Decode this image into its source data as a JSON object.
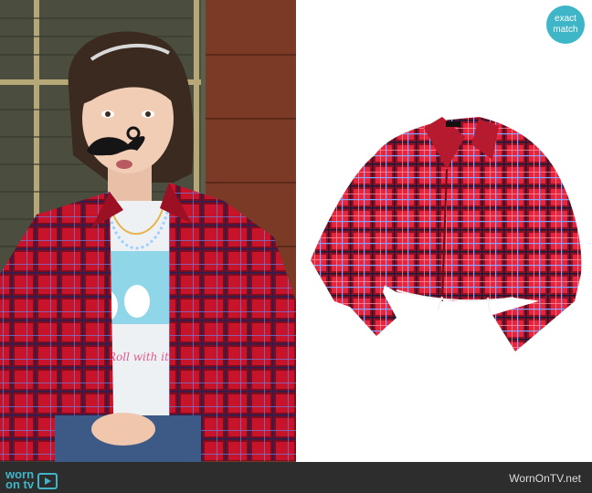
{
  "badge": {
    "line1": "exact",
    "line2": "match"
  },
  "footer": {
    "logo_word1": "worn",
    "logo_word2": "on tv",
    "credit": "WornOnTV.net"
  },
  "colors": {
    "accent": "#3fb6c8",
    "footer_bg": "#2d2d2d",
    "plaid_red": "#d9243a"
  }
}
